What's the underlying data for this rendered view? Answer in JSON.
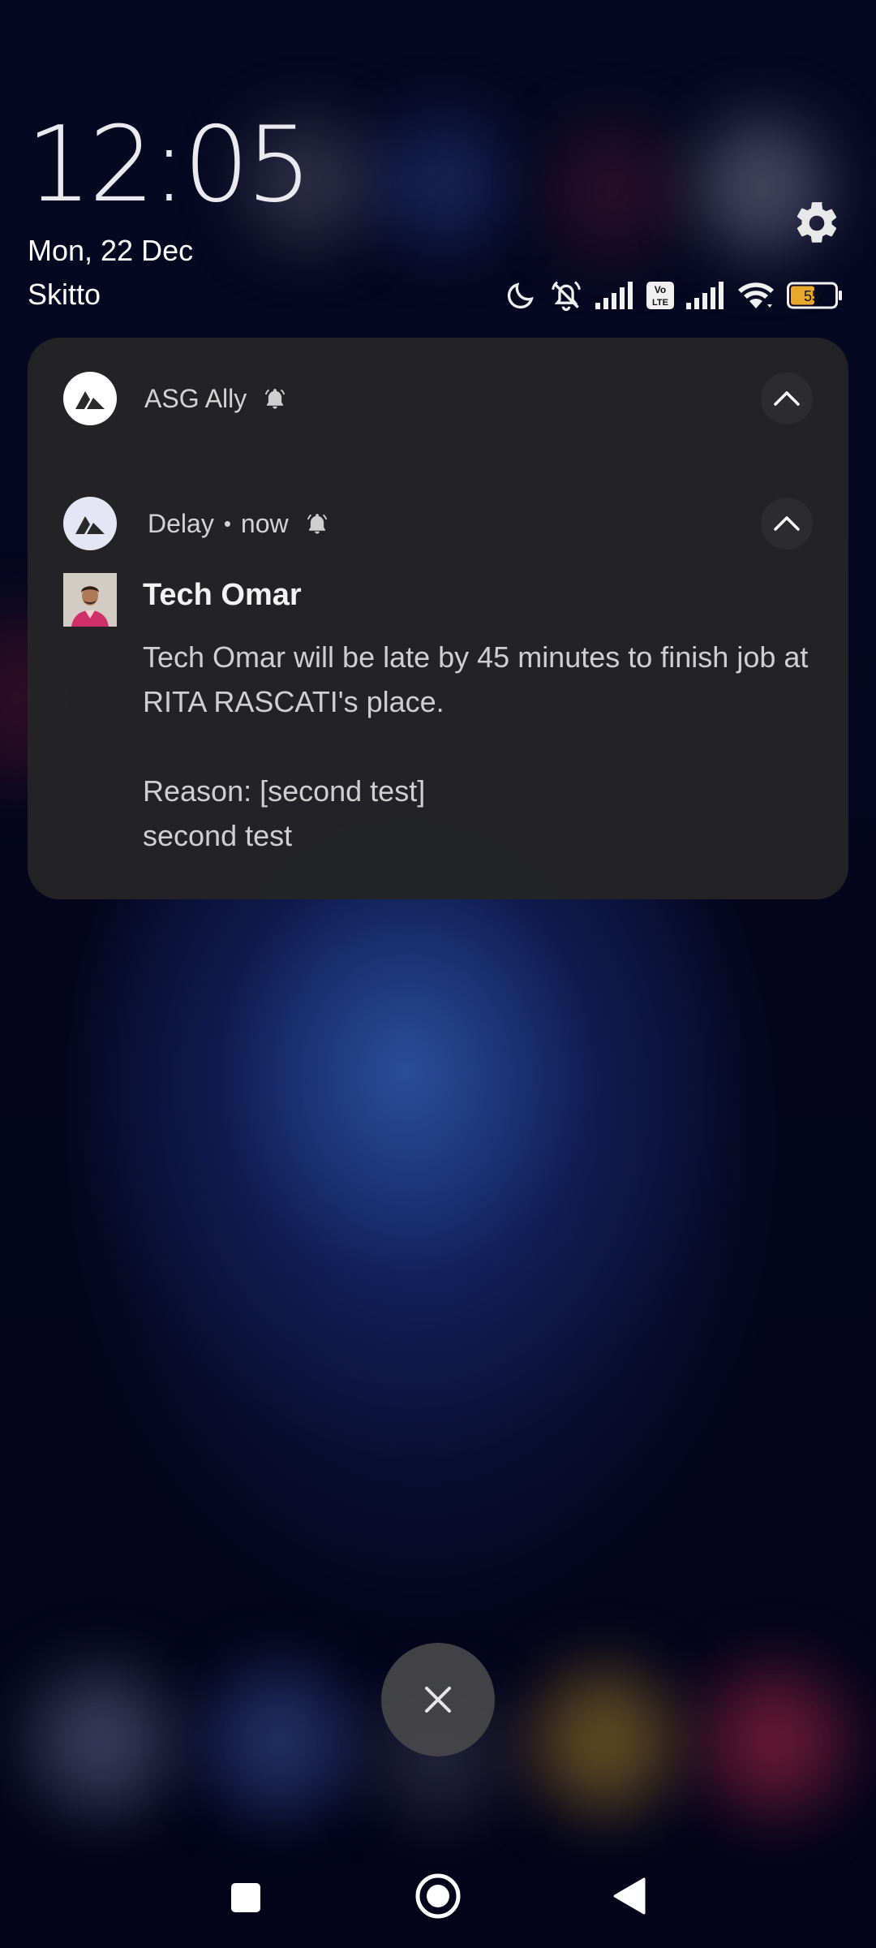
{
  "lockscreen": {
    "time": "12:05",
    "date": "Mon, 22 Dec",
    "carrier": "Skitto"
  },
  "status_bar": {
    "icons": [
      "dnd-moon-icon",
      "alarm-off-icon",
      "signal-bars-icon",
      "volte-icon",
      "signal-bars-icon",
      "wifi-icon",
      "battery-icon"
    ],
    "volte_label": "Vo LTE",
    "battery_level": "55"
  },
  "notification_group": {
    "app_name": "ASG Ally",
    "notification": {
      "channel": "Delay",
      "separator": "•",
      "time": "now",
      "sender": "Tech Omar",
      "message_line1": "Tech Omar will be late by 45 minutes to finish job at RITA RASCATI's place.",
      "reason": "Reason: [second test]",
      "reason_detail": "second test"
    }
  },
  "colors": {
    "card_background": "#242426",
    "accent_battery": "#e8a82c"
  },
  "navigation": {
    "buttons": [
      "recents-square-icon",
      "home-circle-icon",
      "back-triangle-icon"
    ]
  }
}
